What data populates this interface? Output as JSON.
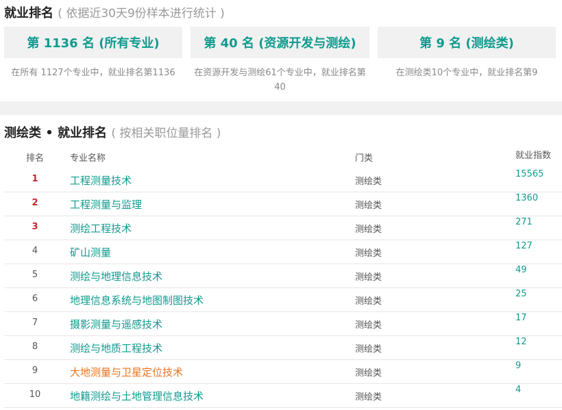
{
  "employment": {
    "title": "就业排名",
    "subtitle": "( 依据近30天9份样本进行统计 )",
    "cards": [
      {
        "label": "第 1136 名 (所有专业)",
        "desc": "在所有 1127个专业中，就业排名第1136"
      },
      {
        "label": "第 40 名 (资源开发与测绘)",
        "desc": "在资源开发与测绘61个专业中，就业排名第40"
      },
      {
        "label": "第 9 名 (测绘类)",
        "desc": "在测绘类10个专业中，就业排名第9"
      }
    ]
  },
  "category_ranking": {
    "title": "测绘类 • 就业排名",
    "subtitle": "( 按相关职位量排名 )",
    "headers": {
      "rank": "排名",
      "name": "专业名称",
      "category": "门类",
      "index": "就业指数"
    },
    "rows": [
      {
        "rank": "1",
        "name": "工程测量技术",
        "category": "测绘类",
        "index": "15565",
        "top": true,
        "highlight": false
      },
      {
        "rank": "2",
        "name": "工程测量与监理",
        "category": "测绘类",
        "index": "1360",
        "top": true,
        "highlight": false
      },
      {
        "rank": "3",
        "name": "测绘工程技术",
        "category": "测绘类",
        "index": "271",
        "top": true,
        "highlight": false
      },
      {
        "rank": "4",
        "name": "矿山测量",
        "category": "测绘类",
        "index": "127",
        "top": false,
        "highlight": false
      },
      {
        "rank": "5",
        "name": "测绘与地理信息技术",
        "category": "测绘类",
        "index": "49",
        "top": false,
        "highlight": false
      },
      {
        "rank": "6",
        "name": "地理信息系统与地图制图技术",
        "category": "测绘类",
        "index": "25",
        "top": false,
        "highlight": false
      },
      {
        "rank": "7",
        "name": "摄影测量与遥感技术",
        "category": "测绘类",
        "index": "17",
        "top": false,
        "highlight": false
      },
      {
        "rank": "8",
        "name": "测绘与地质工程技术",
        "category": "测绘类",
        "index": "12",
        "top": false,
        "highlight": false
      },
      {
        "rank": "9",
        "name": "大地测量与卫星定位技术",
        "category": "测绘类",
        "index": "9",
        "top": false,
        "highlight": true
      },
      {
        "rank": "10",
        "name": "地籍测绘与土地管理信息技术",
        "category": "测绘类",
        "index": "4",
        "top": false,
        "highlight": false
      }
    ]
  },
  "colors": {
    "accent": "#0f9a8e",
    "top_rank": "#c0272d",
    "highlight": "#e8741e",
    "card_bg": "#f1f1f1"
  }
}
